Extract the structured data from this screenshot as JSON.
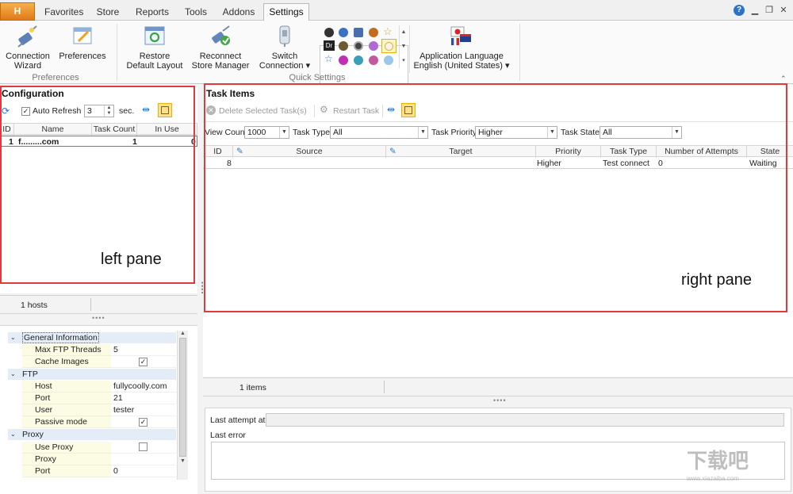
{
  "tabs": {
    "app": "H",
    "favorites": "Favorites",
    "store": "Store",
    "reports": "Reports",
    "tools": "Tools",
    "addons": "Addons",
    "settings": "Settings"
  },
  "ribbon": {
    "connection_wizard": "Connection\nWizard",
    "preferences": "Preferences",
    "preferences_group": "Preferences",
    "restore_layout": "Restore\nDefault Layout",
    "reconnect": "Reconnect\nStore Manager",
    "switch_connection": "Switch\nConnection ▾",
    "quick_settings_group": "Quick Settings",
    "app_language_title": "Application Language",
    "app_language_value": "English (United States) ▾",
    "gallery_dr": "Dr"
  },
  "left": {
    "title": "Configuration",
    "auto_refresh_label": "Auto Refresh",
    "refresh_value": "3",
    "sec_label": "sec.",
    "columns": {
      "id": "ID",
      "name": "Name",
      "task_count": "Task Count",
      "in_use": "In Use"
    },
    "row": {
      "id": "1",
      "name": "f.........com",
      "task_count": "1",
      "in_use": "0"
    },
    "status": "1 hosts",
    "annotation": "left pane"
  },
  "props": {
    "general": "General Information",
    "max_ftp_threads_label": "Max FTP Threads",
    "max_ftp_threads_value": "5",
    "cache_images_label": "Cache Images",
    "ftp": "FTP",
    "host_label": "Host",
    "host_value": "fullycoolly.com",
    "port_label": "Port",
    "port_value": "21",
    "user_label": "User",
    "user_value": "tester",
    "passive_label": "Passive mode",
    "proxy": "Proxy",
    "use_proxy_label": "Use Proxy",
    "proxy_label": "Proxy",
    "proxy_port_label": "Port",
    "proxy_port_value": "0"
  },
  "right": {
    "title": "Task Items",
    "delete_label": "Delete Selected Task(s)",
    "restart_label": "Restart Task",
    "view_count_label": "View Count",
    "view_count_value": "1000",
    "task_type_label": "Task Type",
    "task_type_value": "All",
    "task_priority_label": "Task Priority",
    "task_priority_value": "Higher",
    "task_state_label": "Task State",
    "task_state_value": "All",
    "columns": {
      "id": "ID",
      "source": "Source",
      "target": "Target",
      "priority": "Priority",
      "task_type": "Task Type",
      "attempts": "Number of Attempts",
      "state": "State"
    },
    "row": {
      "id": "8",
      "priority": "Higher",
      "task_type": "Test connect",
      "attempts": "0",
      "state": "Waiting"
    },
    "status": "1 items",
    "annotation": "right pane",
    "last_attempt_label": "Last attempt at",
    "last_error_label": "Last error"
  },
  "watermark": "下载吧 www.xiazaiba.com"
}
